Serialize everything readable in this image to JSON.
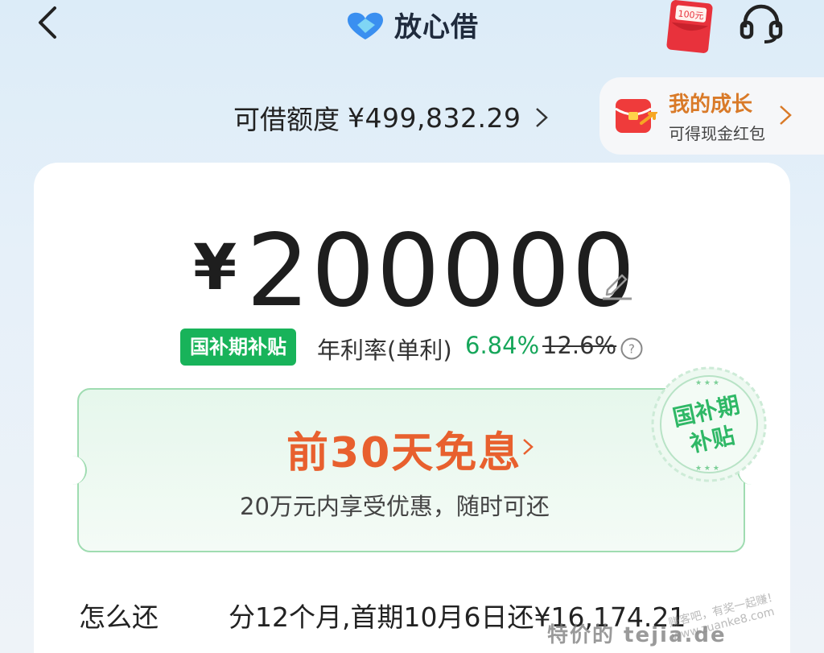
{
  "header": {
    "app_name": "放心借",
    "redpacket_amount": "100元"
  },
  "credit": {
    "label": "可借额度",
    "value": "¥499,832.29"
  },
  "growth": {
    "title": "我的成长",
    "subtitle": "可得现金红包"
  },
  "loan": {
    "currency": "¥",
    "amount": "200000"
  },
  "rate": {
    "tag": "国补期补贴",
    "label": "年利率(单利)",
    "value": "6.84%",
    "old_value": "12.6%"
  },
  "coupon": {
    "title": "前30天免息",
    "description": "20万元内享受优惠，随时可还",
    "stamp_line1": "国补期",
    "stamp_line2": "补贴"
  },
  "repay": {
    "label": "怎么还",
    "value": "分12个月,首期10月6日还¥16,174.21"
  },
  "watermark": {
    "text": "特价的 tejia.de",
    "text2": "赚客吧，有奖一起赚！www.zuanke8.com"
  },
  "colors": {
    "accent_green": "#18b35a",
    "coupon_orange": "#e8602e",
    "growth_orange": "#d97a28"
  }
}
